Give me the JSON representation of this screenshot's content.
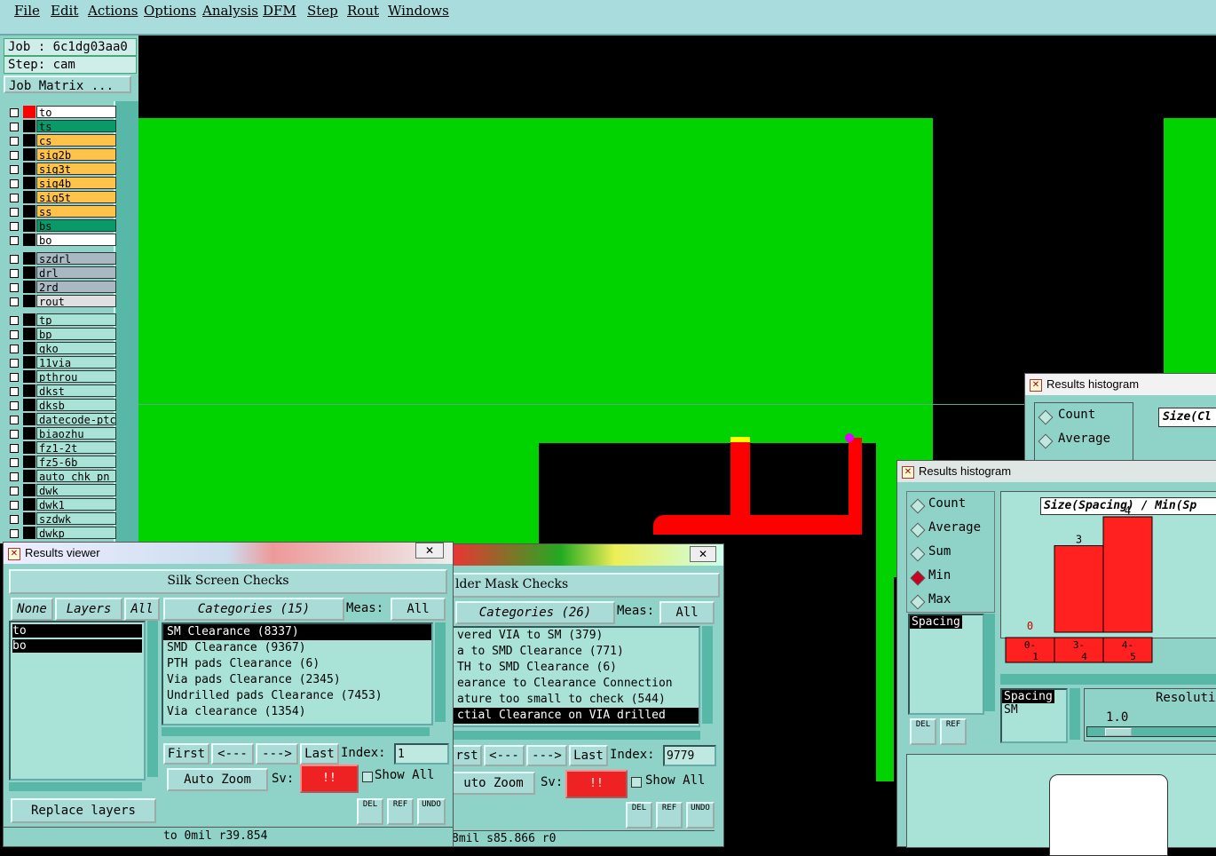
{
  "menu": [
    "File",
    "Edit",
    "Actions",
    "Options",
    "Analysis",
    "DFM",
    "Step",
    "Rout",
    "Windows"
  ],
  "job": {
    "job_label": "Job : 6c1dg03aa0",
    "step_label": "Step: cam",
    "matrix_button": "Job Matrix ..."
  },
  "layers_group1": [
    {
      "name": "to",
      "color": "#ffffff",
      "swatch": "#ff0000"
    },
    {
      "name": "ts",
      "color": "#0a9a6a",
      "swatch": "#000000"
    },
    {
      "name": "cs",
      "color": "#ffc24a",
      "swatch": "#000000"
    },
    {
      "name": "sig2b",
      "color": "#ffc24a",
      "swatch": "#000000"
    },
    {
      "name": "sig3t",
      "color": "#ffc24a",
      "swatch": "#000000"
    },
    {
      "name": "sig4b",
      "color": "#ffc24a",
      "swatch": "#000000"
    },
    {
      "name": "sig5t",
      "color": "#ffc24a",
      "swatch": "#000000"
    },
    {
      "name": "ss",
      "color": "#ffc24a",
      "swatch": "#000000"
    },
    {
      "name": "bs",
      "color": "#0a9a6a",
      "swatch": "#000000"
    },
    {
      "name": "bo",
      "color": "#ffffff",
      "swatch": "#000000"
    }
  ],
  "layers_group2": [
    "szdrl",
    "drl",
    "2rd",
    "rout"
  ],
  "layers_group3": [
    "tp",
    "bp",
    "gko",
    "11via",
    "pthrou",
    "dkst",
    "dksb",
    "datecode-ptc",
    "biaozhu",
    "fz1-2t",
    "fz5-6b",
    "auto_chk_pn",
    "dwk",
    "dwk1",
    "szdwk",
    "dwkp"
  ],
  "viewer1": {
    "title": "Results viewer",
    "header": "Silk Screen Checks",
    "none": "None",
    "layers": "Layers",
    "all": "All",
    "categories": "Categories (15)",
    "meas_label": "Meas:",
    "meas_value": "All",
    "layer_list": [
      "to",
      "bo"
    ],
    "items": [
      "SM Clearance (8337)",
      "SMD Clearance (9367)",
      "PTH pads Clearance (6)",
      "Via pads Clearance (2345)",
      "Undrilled pads Clearance (7453)",
      "Via clearance (1354)"
    ],
    "first": "First",
    "prev": "<---",
    "next": "--->",
    "last": "Last",
    "index_label": "Index:",
    "index_value": "1",
    "zoom": "Auto Zoom",
    "sv_label": "Sv:",
    "sv_value": "!!",
    "show_all": "Show All",
    "replace": "Replace layers",
    "del": "DEL",
    "ref": "REF",
    "undo": "UNDO",
    "status": "to 0mil  r39.854"
  },
  "viewer2": {
    "header": "lder Mask Checks",
    "categories": "Categories (26)",
    "meas_label": "Meas:",
    "meas_value": "All",
    "items": [
      "vered VIA to SM (379)",
      "a to SMD Clearance (771)",
      "TH to SMD Clearance (6)",
      "earance to Clearance Connection",
      "ature too small to check (544)",
      "ctial Clearance on VIA drilled"
    ],
    "prev": "<---",
    "next": "--->",
    "last": "Last",
    "first": "rst",
    "index_label": "Index:",
    "index_value": "9779",
    "zoom": "uto Zoom",
    "sv_label": "Sv:",
    "sv_value": "!!",
    "show_all": "Show All",
    "del": "DEL",
    "ref": "REF",
    "undo": "UNDO",
    "status": "8mil  s85.866  r0"
  },
  "hist_back": {
    "title": "Results histogram",
    "count": "Count",
    "average": "Average",
    "chart_title": "Size(Cl"
  },
  "hist_front": {
    "title": "Results histogram",
    "options": [
      "Count",
      "Average",
      "Sum",
      "Min",
      "Max"
    ],
    "selected": "Min",
    "list": [
      "Spacing"
    ],
    "del": "DEL",
    "ref": "REF",
    "chart_title": "Size(Spacing) / Min(Sp",
    "sel_list": [
      "Spacing",
      "SM"
    ],
    "resolution_label": "Resoluti",
    "resolution_value": "1.0"
  },
  "chart_data": {
    "type": "bar",
    "categories": [
      "0-1",
      "3-4",
      "4-5"
    ],
    "values": [
      0,
      3,
      4
    ],
    "title": "Size(Spacing) / Min(Sp"
  }
}
